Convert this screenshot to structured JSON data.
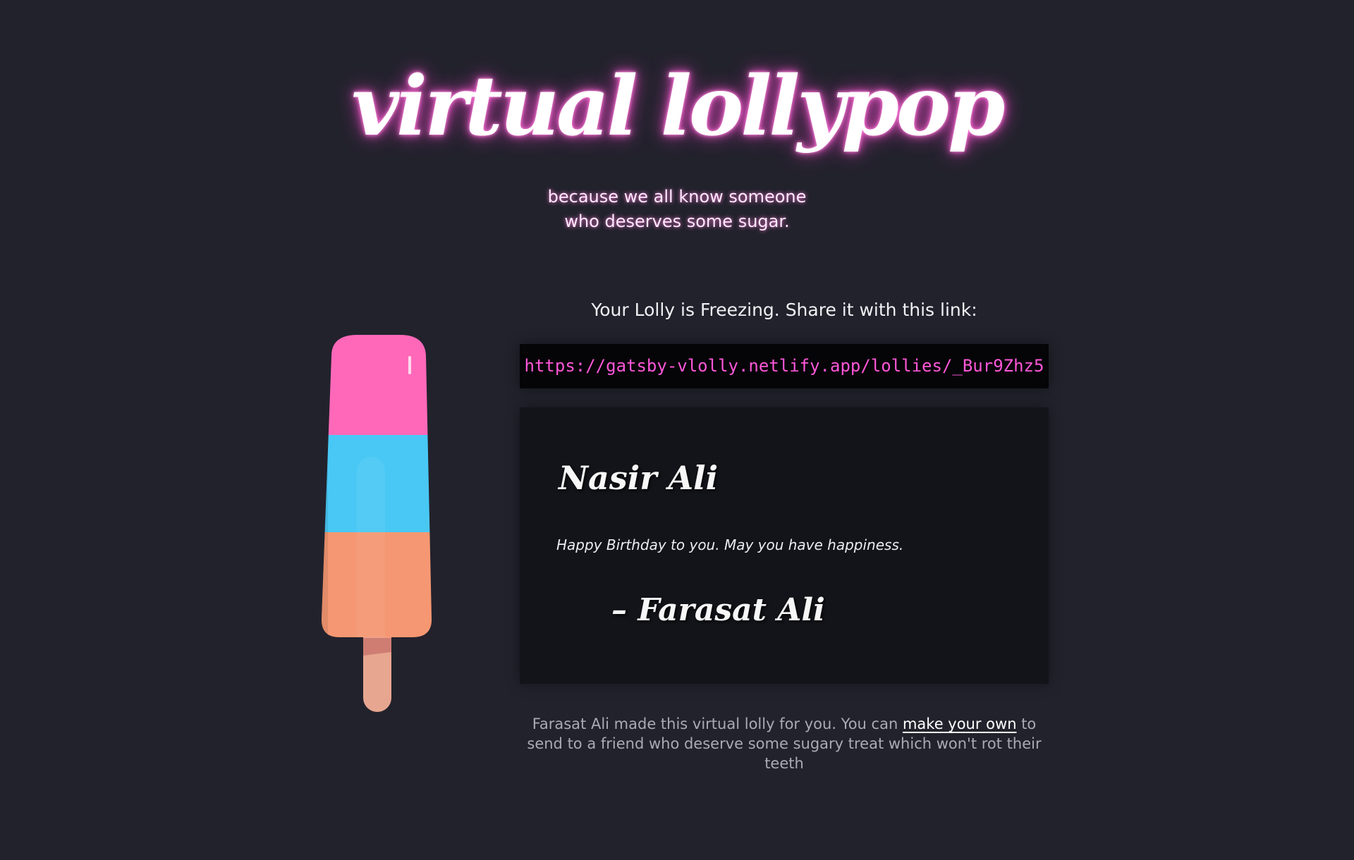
{
  "header": {
    "title": "virtual lollypop",
    "tagline_line1": "because we all know someone",
    "tagline_line2": "who deserves some sugar."
  },
  "share": {
    "heading": "Your Lolly is Freezing. Share it with this link:",
    "link": "https://gatsby-vlolly.netlify.app/lollies/_Bur9Zhz5"
  },
  "lolly": {
    "top_color": "#ff68b9",
    "middle_color": "#49c8f5",
    "bottom_color": "#f59772",
    "stick_color": "#e7a690"
  },
  "message": {
    "recipient": "Nasir Ali",
    "body": "Happy Birthday to you. May you have happiness.",
    "signature": "– Farasat Ali"
  },
  "footer": {
    "text_before": "Farasat Ali made this virtual lolly for you. You can ",
    "link_text": "make your own",
    "text_after": " to send to a friend who deserve some sugary treat which won't rot their teeth"
  }
}
